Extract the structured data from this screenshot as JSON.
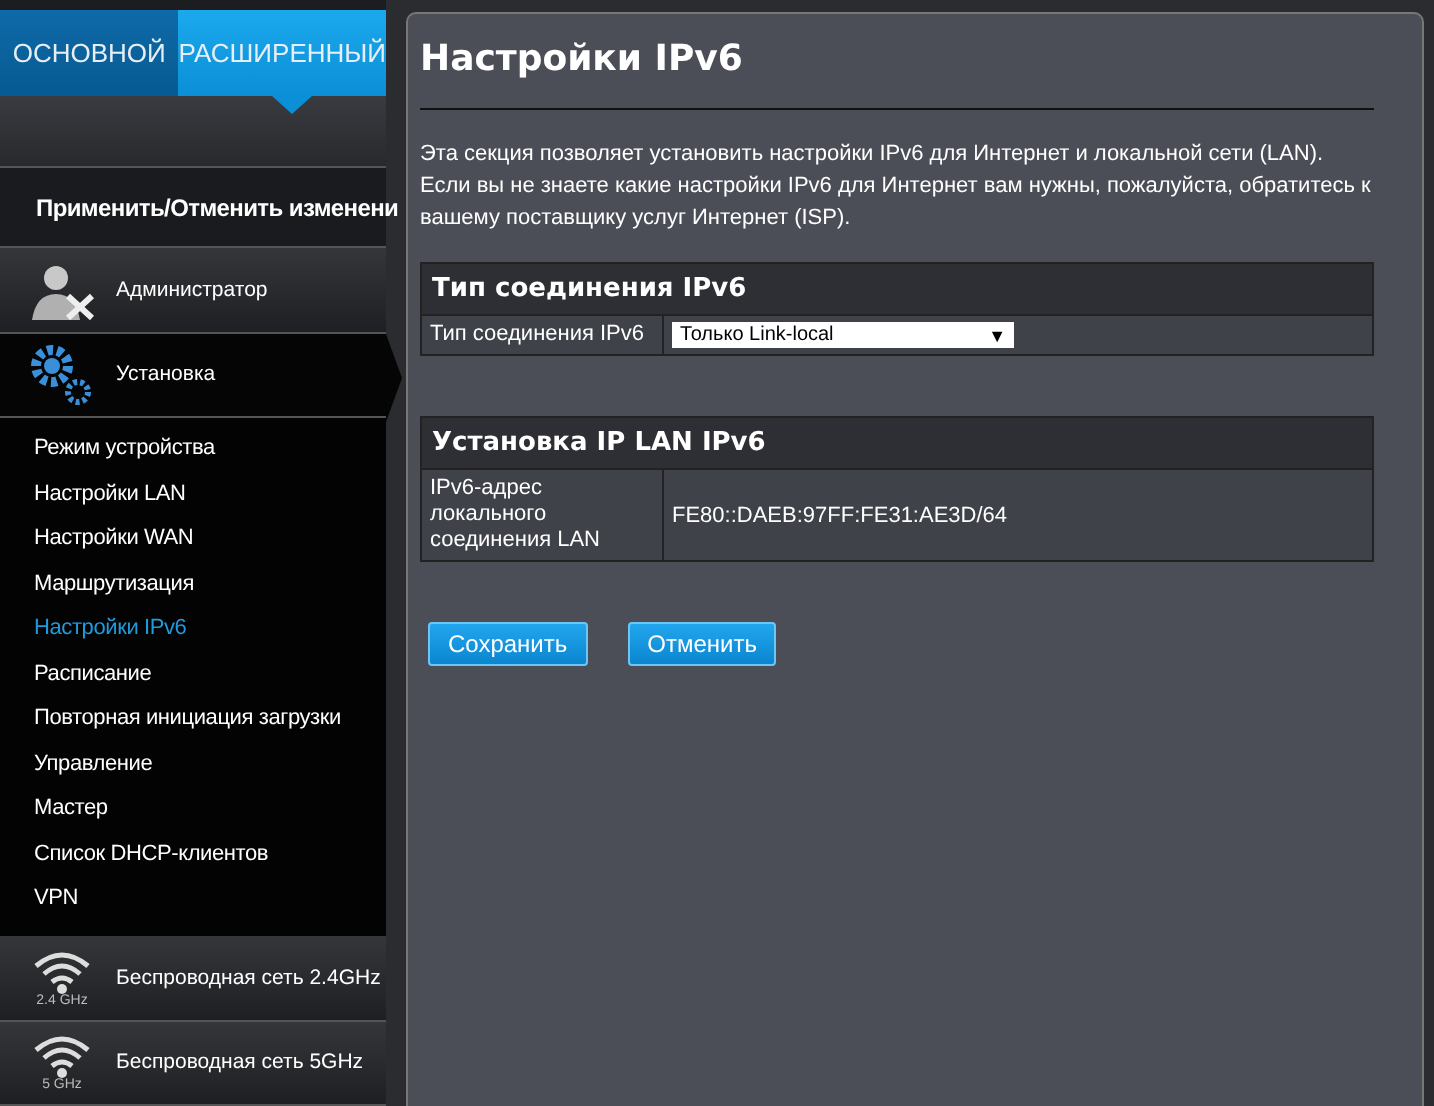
{
  "tabs": [
    {
      "label": "ОСНОВНОЙ",
      "selected": false
    },
    {
      "label": "РАСШИРЕННЫЙ",
      "selected": true
    }
  ],
  "apply_label": "Применить/Отменить изменени",
  "sidebar": {
    "sections": [
      {
        "label": "Администратор",
        "kind": "admin",
        "expanded": false
      },
      {
        "label": "Установка",
        "kind": "gear",
        "expanded": true,
        "items": [
          {
            "label": "Режим устройства",
            "selected": false
          },
          {
            "label": "Настройки LAN",
            "selected": false
          },
          {
            "label": "Настройки WAN",
            "selected": false
          },
          {
            "label": "Маршрутизация",
            "selected": false
          },
          {
            "label": "Настройки IPv6",
            "selected": true
          },
          {
            "label": "Расписание",
            "selected": false
          },
          {
            "label": "Повторная инициация загрузки",
            "selected": false
          },
          {
            "label": "Управление",
            "selected": false
          },
          {
            "label": "Мастер",
            "selected": false
          },
          {
            "label": "Список DHCP-клиентов",
            "selected": false
          },
          {
            "label": "VPN",
            "selected": false
          }
        ]
      },
      {
        "label": "Беспроводная сеть 2.4GHz",
        "kind": "wifi",
        "badge": "2.4 GHz",
        "expanded": false
      },
      {
        "label": "Беспроводная сеть 5GHz",
        "kind": "wifi",
        "badge": "5 GHz",
        "expanded": false
      }
    ]
  },
  "page": {
    "title": "Настройки IPv6",
    "description": "Эта секция позволяет установить настройки IPv6 для Интернет и локальной сети (LAN). Если вы не знаете какие настройки IPv6 для Интернет вам нужны, пожалуйста, обратитесь к вашему поставщику услуг Интернет (ISP).",
    "panels": [
      {
        "title": "Тип соединения IPv6",
        "rows": [
          {
            "kind": "select",
            "label": "Тип соединения IPv6",
            "value": "Только Link-local",
            "arrow": "▼"
          }
        ]
      },
      {
        "title": "Установка IP LAN IPv6",
        "rows": [
          {
            "kind": "text",
            "label": "IPv6-адрес локального соединения LAN",
            "value": "FE80::DAEB:97FF:FE31:AE3D/64"
          }
        ]
      }
    ],
    "buttons": [
      "Сохранить",
      "Отменить"
    ]
  }
}
